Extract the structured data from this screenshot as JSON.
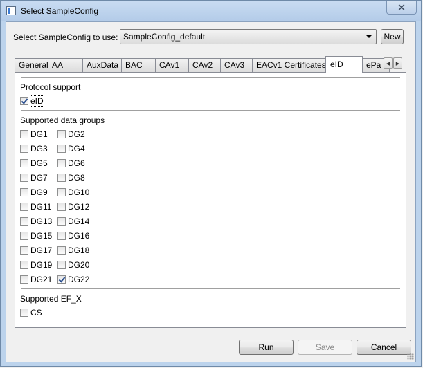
{
  "window": {
    "title": "Select SampleConfig",
    "close_glyph": "✕"
  },
  "config_select": {
    "label": "Select SampleConfig to use:",
    "value": "SampleConfig_default"
  },
  "new_button": "New",
  "tabs": [
    "General",
    "AA",
    "AuxData",
    "BAC",
    "CAv1",
    "CAv2",
    "CAv3",
    "EACv1 Certificates",
    "eID",
    "ePa"
  ],
  "active_tab": "eID",
  "protocol_support": {
    "label": "Protocol support",
    "eid": {
      "label": "eID",
      "checked": true
    }
  },
  "data_groups": {
    "label": "Supported data groups",
    "items": [
      {
        "label": "DG1",
        "checked": false
      },
      {
        "label": "DG2",
        "checked": false
      },
      {
        "label": "DG3",
        "checked": false
      },
      {
        "label": "DG4",
        "checked": false
      },
      {
        "label": "DG5",
        "checked": false
      },
      {
        "label": "DG6",
        "checked": false
      },
      {
        "label": "DG7",
        "checked": false
      },
      {
        "label": "DG8",
        "checked": false
      },
      {
        "label": "DG9",
        "checked": false
      },
      {
        "label": "DG10",
        "checked": false
      },
      {
        "label": "DG11",
        "checked": false
      },
      {
        "label": "DG12",
        "checked": false
      },
      {
        "label": "DG13",
        "checked": false
      },
      {
        "label": "DG14",
        "checked": false
      },
      {
        "label": "DG15",
        "checked": false
      },
      {
        "label": "DG16",
        "checked": false
      },
      {
        "label": "DG17",
        "checked": false
      },
      {
        "label": "DG18",
        "checked": false
      },
      {
        "label": "DG19",
        "checked": false
      },
      {
        "label": "DG20",
        "checked": false
      },
      {
        "label": "DG21",
        "checked": false
      },
      {
        "label": "DG22",
        "checked": true
      }
    ]
  },
  "ef_x": {
    "label": "Supported EF_X",
    "cs": {
      "label": "CS",
      "checked": false
    }
  },
  "buttons": {
    "run": "Run",
    "save": "Save",
    "cancel": "Cancel"
  },
  "icons": {
    "tab_left": "◀",
    "tab_right": "▶"
  }
}
